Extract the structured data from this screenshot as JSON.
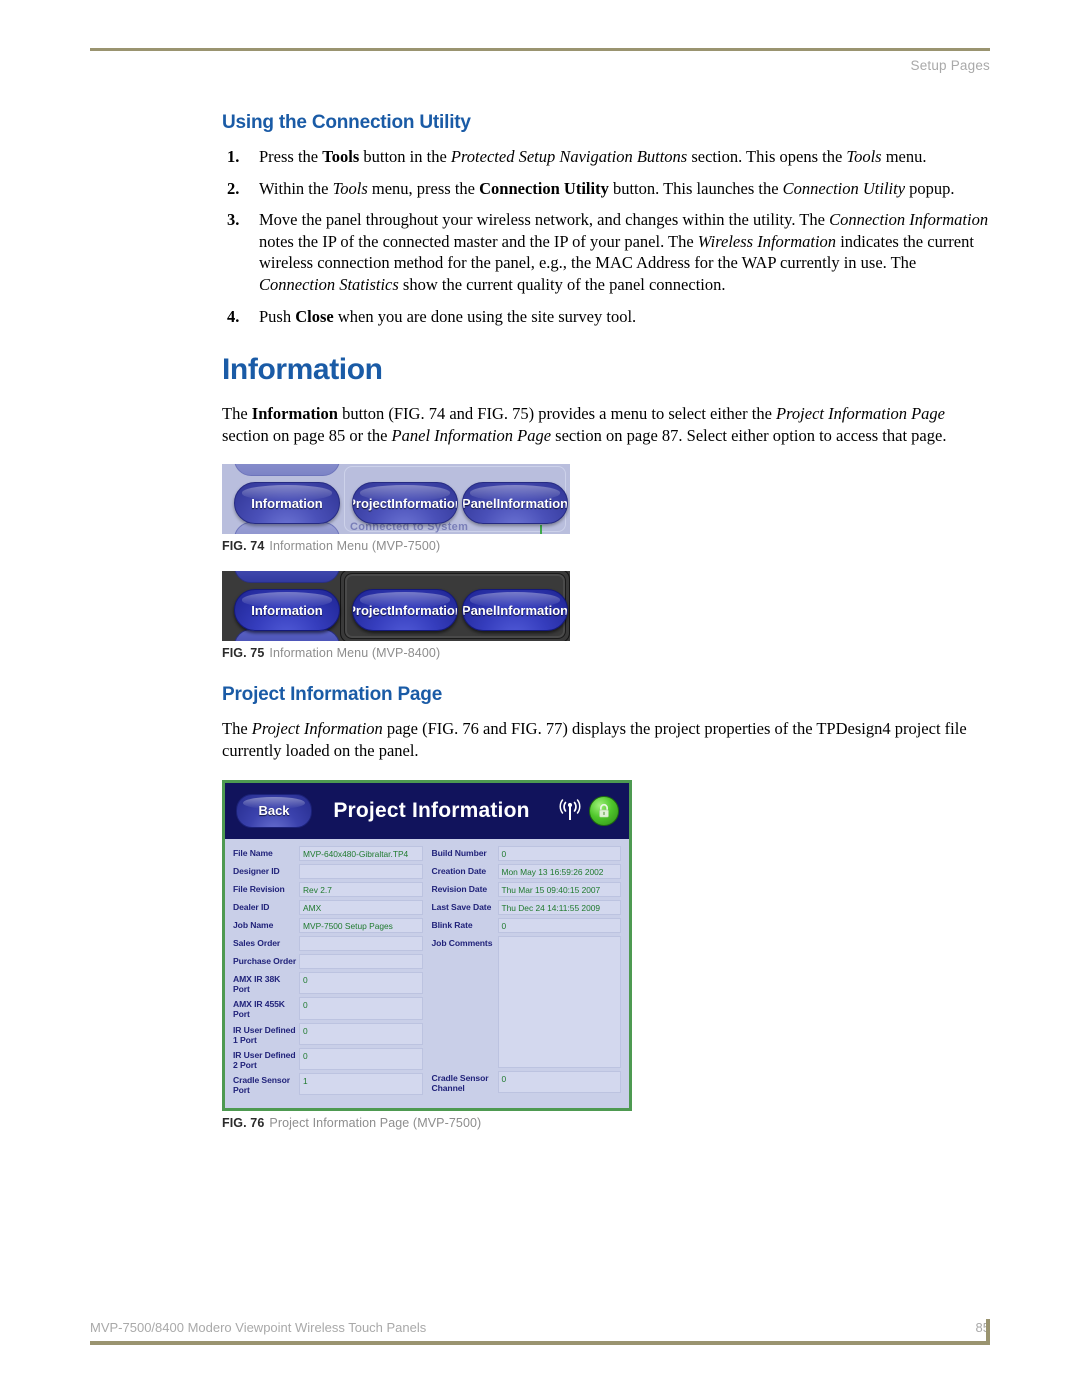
{
  "header": {
    "running_head": "Setup Pages"
  },
  "sections": {
    "connection_utility": {
      "heading": "Using the Connection Utility",
      "steps": [
        {
          "num": "1.",
          "parts": [
            {
              "t": "Press the ",
              "s": "n"
            },
            {
              "t": "Tools",
              "s": "b"
            },
            {
              "t": " button in the ",
              "s": "n"
            },
            {
              "t": "Protected Setup Navigation Buttons",
              "s": "i"
            },
            {
              "t": " section. This opens the ",
              "s": "n"
            },
            {
              "t": "Tools",
              "s": "i"
            },
            {
              "t": " menu.",
              "s": "n"
            }
          ]
        },
        {
          "num": "2.",
          "parts": [
            {
              "t": "Within the ",
              "s": "n"
            },
            {
              "t": "Tools",
              "s": "i"
            },
            {
              "t": " menu, press the ",
              "s": "n"
            },
            {
              "t": "Connection Utility",
              "s": "b"
            },
            {
              "t": " button. This launches the ",
              "s": "n"
            },
            {
              "t": "Connection Utility",
              "s": "i"
            },
            {
              "t": " popup.",
              "s": "n"
            }
          ]
        },
        {
          "num": "3.",
          "parts": [
            {
              "t": "Move the panel throughout your wireless network, and changes within the utility. The ",
              "s": "n"
            },
            {
              "t": "Connection Information",
              "s": "i"
            },
            {
              "t": " notes the IP of the connected master and the IP of your panel. The ",
              "s": "n"
            },
            {
              "t": "Wireless Information",
              "s": "i"
            },
            {
              "t": " indicates the current wireless connection method for the panel, e.g., the MAC Address for the WAP currently in use. The ",
              "s": "n"
            },
            {
              "t": "Connection Statistics",
              "s": "i"
            },
            {
              "t": " show the current quality of the panel connection.",
              "s": "n"
            }
          ]
        },
        {
          "num": "4.",
          "parts": [
            {
              "t": "Push ",
              "s": "n"
            },
            {
              "t": "Close",
              "s": "b"
            },
            {
              "t": " when you are done using the site survey tool.",
              "s": "n"
            }
          ]
        }
      ]
    },
    "information": {
      "heading": "Information",
      "paragraph": [
        {
          "t": "The ",
          "s": "n"
        },
        {
          "t": "Information",
          "s": "b"
        },
        {
          "t": " button (FIG. 74 and FIG. 75) provides a menu to select either the ",
          "s": "n"
        },
        {
          "t": "Project Information Page",
          "s": "i"
        },
        {
          "t": " section on page 85 or the ",
          "s": "n"
        },
        {
          "t": "Panel Information Page",
          "s": "i"
        },
        {
          "t": " section on page 87. Select either option to access that page.",
          "s": "n"
        }
      ]
    },
    "project_information": {
      "heading": "Project Information Page",
      "paragraph": [
        {
          "t": "The ",
          "s": "n"
        },
        {
          "t": "Project Information",
          "s": "i"
        },
        {
          "t": " page (FIG. 76 and FIG. 77) displays the project properties of the TPDesign4 project file currently loaded on the panel.",
          "s": "n"
        }
      ]
    }
  },
  "figures": {
    "fig74": {
      "label": "FIG. 74",
      "caption": "Information Menu (MVP-7500)",
      "buttons": [
        "Information",
        "Project\nInformation",
        "Panel\nInformation"
      ],
      "partial_text": "Connected to System"
    },
    "fig75": {
      "label": "FIG. 75",
      "caption": "Information Menu (MVP-8400)",
      "buttons": [
        "Information",
        "Project\nInformation",
        "Panel\nInformation"
      ]
    },
    "fig76": {
      "label": "FIG. 76",
      "caption": "Project Information Page (MVP-7500)"
    }
  },
  "panel": {
    "back_label": "Back",
    "title": "Project Information",
    "icons": {
      "wireless": "wifi-antenna-icon",
      "lock": "green-lock-icon"
    },
    "left_fields": [
      {
        "label": "File Name",
        "value": "MVP-640x480-Gibraltar.TP4"
      },
      {
        "label": "Designer ID",
        "value": ""
      },
      {
        "label": "File Revision",
        "value": "Rev 2.7"
      },
      {
        "label": "Dealer ID",
        "value": "AMX"
      },
      {
        "label": "Job Name",
        "value": "MVP-7500 Setup Pages"
      },
      {
        "label": "Sales Order",
        "value": ""
      },
      {
        "label": "Purchase Order",
        "value": ""
      },
      {
        "label": "AMX IR 38K Port",
        "value": "0"
      },
      {
        "label": "AMX IR 455K Port",
        "value": "0"
      },
      {
        "label": "IR User Defined 1 Port",
        "value": "0"
      },
      {
        "label": "IR User Defined 2 Port",
        "value": "0"
      },
      {
        "label": "Cradle Sensor Port",
        "value": "1"
      }
    ],
    "right_fields": [
      {
        "label": "Build Number",
        "value": "0"
      },
      {
        "label": "Creation Date",
        "value": "Mon May 13 16:59:26 2002"
      },
      {
        "label": "Revision Date",
        "value": "Thu Mar 15 09:40:15 2007"
      },
      {
        "label": "Last Save Date",
        "value": "Thu Dec 24 14:11:55 2009"
      },
      {
        "label": "Blink Rate",
        "value": "0"
      },
      {
        "label": "Job Comments",
        "value": ""
      },
      {
        "label": "Cradle Sensor Channel",
        "value": "0"
      }
    ]
  },
  "footer": {
    "text": "MVP-7500/8400 Modero Viewpoint Wireless Touch Panels",
    "page_number": "85"
  },
  "colors": {
    "heading_blue": "#1a5ba6",
    "rule_tan": "#9a9470",
    "panel_border_green": "#4e9a51",
    "panel_header_navy": "#11135c",
    "value_green": "#1f7a2e"
  }
}
